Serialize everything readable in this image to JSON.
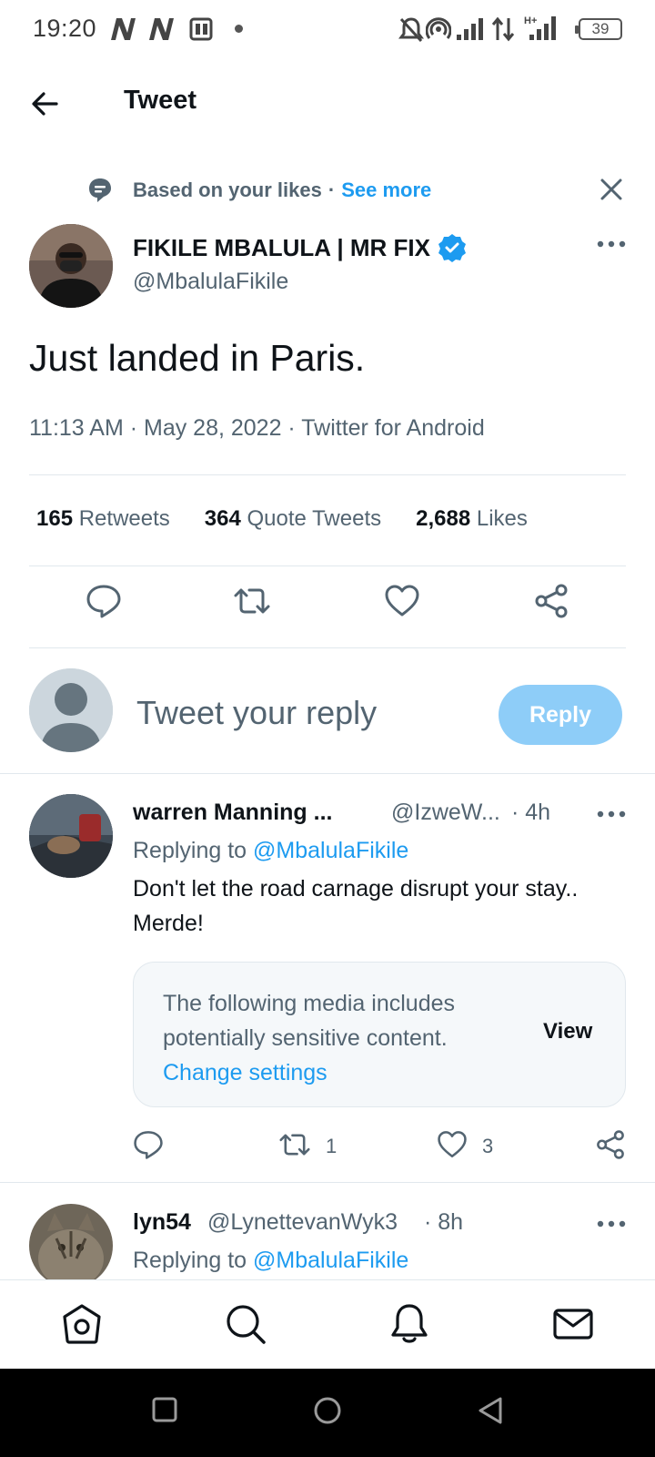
{
  "status_bar": {
    "time": "19:20",
    "battery": "39"
  },
  "header": {
    "title": "Tweet"
  },
  "context": {
    "label": "Based on your likes",
    "separator": "·",
    "see_more": "See more"
  },
  "tweet": {
    "author_name": "FIKILE MBALULA | MR FIX",
    "author_handle": "@MbalulaFikile",
    "text": "Just landed in Paris.",
    "meta": "11:13 AM · May 28, 2022 · Twitter for Android",
    "stats": {
      "retweets_count": "165",
      "retweets_label": "Retweets",
      "quotes_count": "364",
      "quotes_label": "Quote Tweets",
      "likes_count": "2,688",
      "likes_label": "Likes"
    }
  },
  "composer": {
    "placeholder": "Tweet your reply",
    "button": "Reply"
  },
  "replies": [
    {
      "name": "warren Manning ...",
      "handle": "@IzweW...",
      "time": "· 4h",
      "replying_prefix": "Replying to",
      "replying_to": "@MbalulaFikile",
      "text": "Don't let the road carnage disrupt your stay.. Merde!",
      "sensitive_text": "The following media includes potentially sensitive content.",
      "change_settings": "Change settings",
      "view": "View",
      "retweets": "1",
      "likes": "3"
    },
    {
      "name": "lyn54",
      "handle": "@LynettevanWyk3",
      "time": "· 8h",
      "replying_prefix": "Replying to",
      "replying_to": "@MbalulaFikile"
    }
  ],
  "colors": {
    "accent": "#1d9bf0",
    "reply_button_disabled": "#8ecdf8",
    "text_secondary": "#536471"
  }
}
